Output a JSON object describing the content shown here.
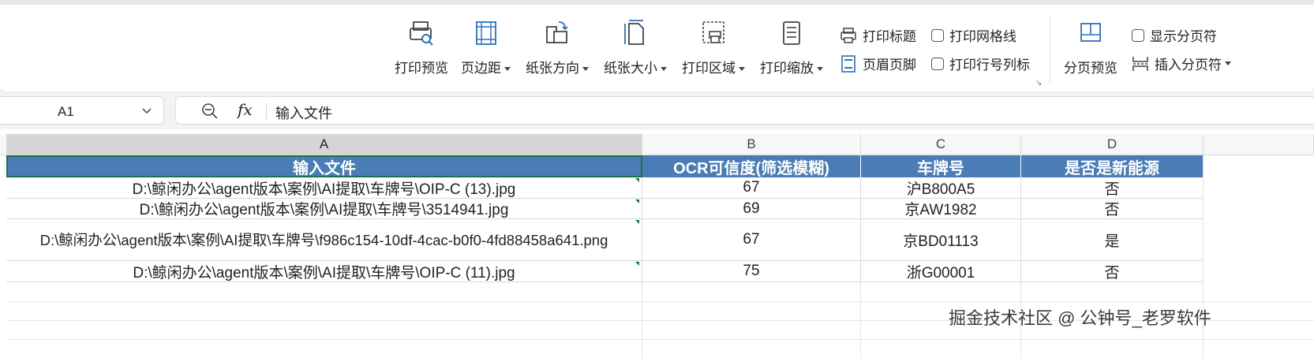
{
  "ribbon": {
    "print_preview": "打印预览",
    "margins": "页边距",
    "orientation": "纸张方向",
    "paper_size": "纸张大小",
    "print_area": "打印区域",
    "print_scale": "打印缩放",
    "print_titles": "打印标题",
    "header_footer": "页眉页脚",
    "print_gridlines": "打印网格线",
    "print_row_col_headers": "打印行号列标",
    "page_break_preview": "分页预览",
    "show_page_breaks": "显示分页符",
    "insert_page_break": "插入分页符"
  },
  "formula_bar": {
    "name_box": "A1",
    "fx": "fx",
    "value": "输入文件"
  },
  "columns": [
    "A",
    "B",
    "C",
    "D"
  ],
  "table": {
    "headers": [
      "输入文件",
      "OCR可信度(筛选模糊)",
      "车牌号",
      "是否是新能源"
    ],
    "rows": [
      [
        "D:\\鲸闲办公\\agent版本\\案例\\AI提取\\车牌号\\OIP-C (13).jpg",
        "67",
        "沪B800A5",
        "否"
      ],
      [
        "D:\\鲸闲办公\\agent版本\\案例\\AI提取\\车牌号\\3514941.jpg",
        "69",
        "京AW1982",
        "否"
      ],
      [
        "D:\\鲸闲办公\\agent版本\\案例\\AI提取\\车牌号\\f986c154-10df-4cac-b0f0-4fd88458a641.png",
        "67",
        "京BD01113",
        "是"
      ],
      [
        "D:\\鲸闲办公\\agent版本\\案例\\AI提取\\车牌号\\OIP-C (11).jpg",
        "75",
        "浙G00001",
        "否"
      ]
    ]
  },
  "watermark": "掘金技术社区 @ 公钟号_老罗软件",
  "colors": {
    "header_fill": "#4a7db5",
    "selection": "#1e7145"
  }
}
